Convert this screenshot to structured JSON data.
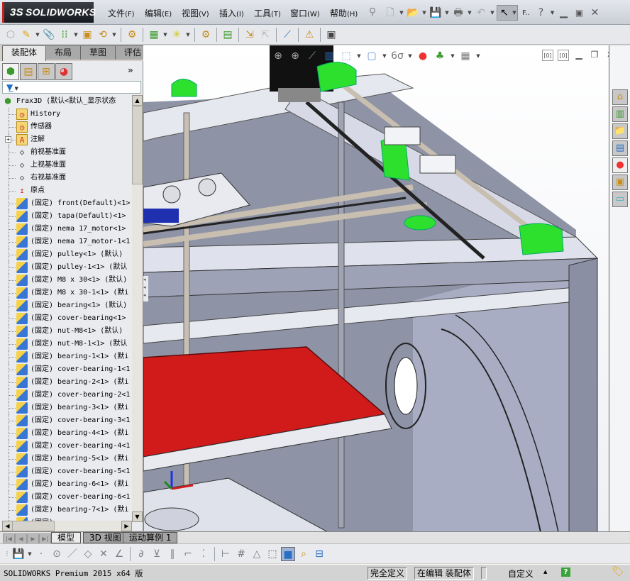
{
  "app": {
    "brand": "SOLIDWORKS",
    "brand_mark": "3S"
  },
  "menu": [
    {
      "label": "文件",
      "key": "(F)"
    },
    {
      "label": "编辑",
      "key": "(E)"
    },
    {
      "label": "视图",
      "key": "(V)"
    },
    {
      "label": "插入",
      "key": "(I)"
    },
    {
      "label": "工具",
      "key": "(T)"
    },
    {
      "label": "窗口",
      "key": "(W)"
    },
    {
      "label": "帮助",
      "key": "(H)"
    }
  ],
  "quick_access": {
    "icons": [
      "pin-icon",
      "new-document-icon",
      "open-icon",
      "save-icon",
      "print-icon",
      "undo-icon",
      "select-icon"
    ],
    "filter_label": "F..",
    "help_icon": "question-icon",
    "window_buttons": [
      "minimize-icon",
      "maximize-icon",
      "close-icon"
    ]
  },
  "command_tabs": [
    {
      "label": "装配体",
      "active": true
    },
    {
      "label": "布局",
      "active": false
    },
    {
      "label": "草图",
      "active": false
    },
    {
      "label": "评估",
      "active": false
    }
  ],
  "panel": {
    "tabs": [
      "featuremanager-icon",
      "propertymanager-icon",
      "configurationmanager-icon",
      "displaymanager-icon"
    ],
    "expand_label": "»",
    "filter_icon": "filter-icon",
    "root": "Frax3D  (默认<默认_显示状态",
    "tree": [
      {
        "label": "History",
        "icon": "history-icon",
        "type": "folder"
      },
      {
        "label": "传感器",
        "icon": "sensor-icon",
        "type": "folder"
      },
      {
        "label": "注解",
        "icon": "annotation-icon",
        "type": "folder",
        "expandable": true
      },
      {
        "label": "前视基准面",
        "icon": "plane-icon",
        "type": "plane"
      },
      {
        "label": "上视基准面",
        "icon": "plane-icon",
        "type": "plane"
      },
      {
        "label": "右视基准面",
        "icon": "plane-icon",
        "type": "plane"
      },
      {
        "label": "原点",
        "icon": "origin-icon",
        "type": "origin"
      },
      {
        "label": "(固定) front(Default)<1>",
        "icon": "component-icon",
        "type": "comp"
      },
      {
        "label": "(固定) tapa(Default)<1>",
        "icon": "component-icon",
        "type": "comp"
      },
      {
        "label": "(固定) nema 17_motor<1>",
        "icon": "component-icon",
        "type": "comp"
      },
      {
        "label": "(固定) nema 17_motor-1<1",
        "icon": "component-icon",
        "type": "comp"
      },
      {
        "label": "(固定) pulley<1> (默认)",
        "icon": "component-icon",
        "type": "comp"
      },
      {
        "label": "(固定) pulley-1<1> (默认",
        "icon": "component-icon",
        "type": "comp"
      },
      {
        "label": "(固定) M8 x 30<1> (默认)",
        "icon": "component-icon",
        "type": "comp"
      },
      {
        "label": "(固定) M8 x 30-1<1> (默i",
        "icon": "component-icon",
        "type": "comp"
      },
      {
        "label": "(固定) bearing<1> (默认)",
        "icon": "component-icon",
        "type": "comp"
      },
      {
        "label": "(固定) cover-bearing<1>",
        "icon": "component-icon",
        "type": "comp"
      },
      {
        "label": "(固定) nut-M8<1> (默认)",
        "icon": "component-icon",
        "type": "comp"
      },
      {
        "label": "(固定) nut-M8-1<1> (默认",
        "icon": "component-icon",
        "type": "comp"
      },
      {
        "label": "(固定) bearing-1<1> (默i",
        "icon": "component-icon",
        "type": "comp"
      },
      {
        "label": "(固定) cover-bearing-1<1",
        "icon": "component-icon",
        "type": "comp"
      },
      {
        "label": "(固定) bearing-2<1> (默i",
        "icon": "component-icon",
        "type": "comp"
      },
      {
        "label": "(固定) cover-bearing-2<1",
        "icon": "component-icon",
        "type": "comp"
      },
      {
        "label": "(固定) bearing-3<1> (默i",
        "icon": "component-icon",
        "type": "comp"
      },
      {
        "label": "(固定) cover-bearing-3<1",
        "icon": "component-icon",
        "type": "comp"
      },
      {
        "label": "(固定) bearing-4<1> (默i",
        "icon": "component-icon",
        "type": "comp"
      },
      {
        "label": "(固定) cover-bearing-4<1",
        "icon": "component-icon",
        "type": "comp"
      },
      {
        "label": "(固定) bearing-5<1> (默i",
        "icon": "component-icon",
        "type": "comp"
      },
      {
        "label": "(固定) cover-bearing-5<1",
        "icon": "component-icon",
        "type": "comp"
      },
      {
        "label": "(固定) bearing-6<1> (默i",
        "icon": "component-icon",
        "type": "comp"
      },
      {
        "label": "(固定) cover-bearing-6<1",
        "icon": "component-icon",
        "type": "comp"
      },
      {
        "label": "(固定) bearing-7<1> (默i",
        "icon": "component-icon",
        "type": "comp"
      },
      {
        "label": "(固定)",
        "icon": "component-icon",
        "type": "comp"
      }
    ]
  },
  "viewport": {
    "heads_up_icons": [
      "zoom-to-fit-icon",
      "zoom-area-icon",
      "previous-view-icon",
      "section-view-icon",
      "view-orientation-icon",
      "display-style-icon",
      "hide-show-icon",
      "appearance-icon",
      "scene-icon",
      "view-settings-icon"
    ],
    "window_icons": [
      "split-left-icon",
      "split-right-icon",
      "minimize-icon",
      "restore-icon",
      "close-icon"
    ],
    "triad": {
      "x": "x",
      "y": "y",
      "z": "z"
    }
  },
  "task_pane": [
    "solidworks-resources-icon",
    "design-library-icon",
    "file-explorer-icon",
    "view-palette-icon",
    "appearances-icon",
    "custom-properties-icon",
    "forum-icon"
  ],
  "bottom_tabs": {
    "nav": [
      "first-icon",
      "prev-icon",
      "next-icon",
      "last-icon"
    ],
    "tabs": [
      {
        "label": "模型",
        "active": true
      },
      {
        "label": "3D 视图",
        "active": false
      },
      {
        "label": "运动算例 1",
        "active": false
      }
    ]
  },
  "sketch_toolbar": [
    "save-icon",
    "point-icon",
    "circle-icon",
    "line-icon",
    "polygon-icon",
    "trim-icon",
    "angle-icon",
    "offset-icon",
    "mirror-icon",
    "parallel-icon",
    "corner-icon",
    "dotted-line-icon",
    "dimension-icon",
    "grid-icon",
    "triangle-icon",
    "wireframe-cube-icon",
    "shaded-cube-icon",
    "measure-icon",
    "table-icon"
  ],
  "status": {
    "product": "SOLIDWORKS Premium 2015 x64 版",
    "definition": "完全定义",
    "editing": "在编辑 装配体",
    "units": "自定义",
    "units_arrow": "▲",
    "help": "?",
    "tag_icon": "tag-icon"
  }
}
